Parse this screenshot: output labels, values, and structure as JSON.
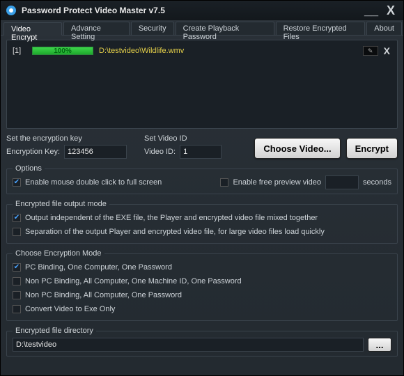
{
  "titlebar": {
    "title": "Password Protect Video Master v7.5"
  },
  "tabs": [
    "Video Encrypt",
    "Advance Setting",
    "Security",
    "Create Playback Password",
    "Restore Encrypted Files",
    "About"
  ],
  "filelist": {
    "items": [
      {
        "index": "[1]",
        "progress": "100%",
        "path": "D:\\testvideo\\Wildlife.wmv"
      }
    ]
  },
  "encrypt_key_section": {
    "title": "Set the encryption key",
    "label": "Encryption Key:",
    "value": "123456"
  },
  "video_id_section": {
    "title": "Set Video ID",
    "label": "Video ID:",
    "value": "1"
  },
  "buttons": {
    "choose": "Choose Video...",
    "encrypt": "Encrypt",
    "browse": "..."
  },
  "options": {
    "legend": "Options",
    "opt1": "Enable mouse double click to full screen",
    "opt2": "Enable free preview video",
    "seconds_value": "",
    "seconds_suffix": "seconds"
  },
  "output_mode": {
    "legend": "Encrypted file output mode",
    "opt1": "Output independent of the EXE file, the Player and encrypted video file mixed together",
    "opt2": "Separation of the output Player and encrypted video file, for large video files load quickly"
  },
  "enc_mode": {
    "legend": "Choose Encryption Mode",
    "opt1": "PC Binding, One Computer, One Password",
    "opt2": "Non PC Binding, All Computer, One Machine ID, One Password",
    "opt3": "Non PC Binding, All Computer, One Password",
    "opt4": "Convert Video to Exe Only"
  },
  "directory": {
    "legend": "Encrypted file directory",
    "value": "D:\\testvideo"
  }
}
